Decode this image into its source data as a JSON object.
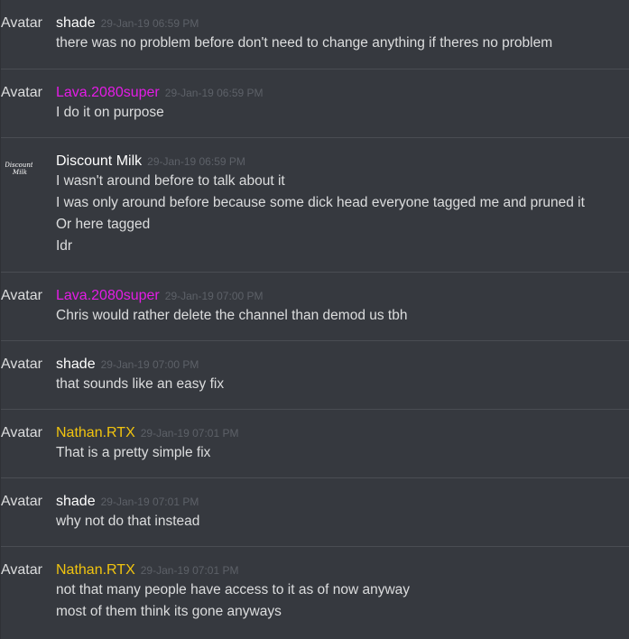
{
  "colors": {
    "background": "#36393f",
    "divider": "#4a4d53",
    "text": "#dcddde",
    "timestamp": "#5d6168",
    "user_white": "#ffffff",
    "user_magenta": "#e41ce6",
    "user_gold": "#f1c40f"
  },
  "messages": [
    {
      "avatar_text": "Avatar",
      "username": "shade",
      "user_color": "#ffffff",
      "timestamp": "29-Jan-19 06:59 PM",
      "lines": [
        "there was no problem before don't need to change anything if theres no problem"
      ]
    },
    {
      "avatar_text": "Avatar",
      "username": "Lava.2080super",
      "user_color": "#e41ce6",
      "timestamp": "29-Jan-19 06:59 PM",
      "lines": [
        "I do it on purpose"
      ]
    },
    {
      "avatar_text": "",
      "avatar_image": "discount-milk-logo",
      "avatar_logo_text": "Discount Milk",
      "username": "Discount Milk",
      "user_color": "#ffffff",
      "timestamp": "29-Jan-19 06:59 PM",
      "lines": [
        "I wasn't around before to talk about it",
        "I was only around before because some dick head everyone tagged me and pruned it",
        "Or here tagged",
        "Idr"
      ]
    },
    {
      "avatar_text": "Avatar",
      "username": "Lava.2080super",
      "user_color": "#e41ce6",
      "timestamp": "29-Jan-19 07:00 PM",
      "lines": [
        "Chris would rather delete the channel than demod us tbh"
      ]
    },
    {
      "avatar_text": "Avatar",
      "username": "shade",
      "user_color": "#ffffff",
      "timestamp": "29-Jan-19 07:00 PM",
      "lines": [
        "that sounds like an easy fix"
      ]
    },
    {
      "avatar_text": "Avatar",
      "username": "Nathan.RTX",
      "user_color": "#f1c40f",
      "timestamp": "29-Jan-19 07:01 PM",
      "lines": [
        "That is a pretty simple fix"
      ]
    },
    {
      "avatar_text": "Avatar",
      "username": "shade",
      "user_color": "#ffffff",
      "timestamp": "29-Jan-19 07:01 PM",
      "lines": [
        "why not do that instead"
      ]
    },
    {
      "avatar_text": "Avatar",
      "username": "Nathan.RTX",
      "user_color": "#f1c40f",
      "timestamp": "29-Jan-19 07:01 PM",
      "lines": [
        "not that many people have access to it as of now anyway",
        "most of them think its gone anyways"
      ]
    }
  ]
}
